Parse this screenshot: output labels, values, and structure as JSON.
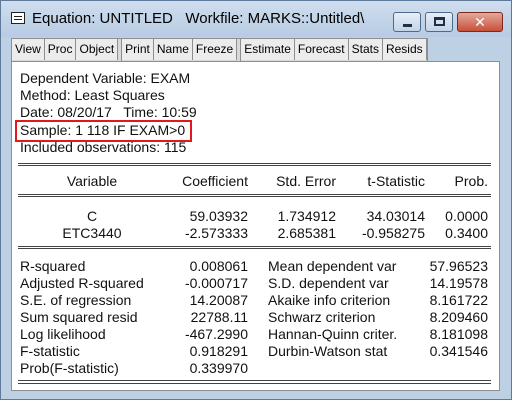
{
  "window": {
    "title": "Equation: UNTITLED   Workfile: MARKS::Untitled\\",
    "controls": {
      "minimize_icon": "minimize-icon",
      "maximize_icon": "maximize-icon",
      "close_icon": "close-icon",
      "close_glyph": "✕"
    }
  },
  "toolbar": {
    "buttons": [
      "View",
      "Proc",
      "Object",
      "Print",
      "Name",
      "Freeze",
      "Estimate",
      "Forecast",
      "Stats",
      "Resids"
    ]
  },
  "output": {
    "header": {
      "dependent": "Dependent Variable: EXAM",
      "method": "Method: Least Squares",
      "date": "Date: 08/20/17   Time: 10:59",
      "sample": "Sample: 1 118 IF EXAM>0",
      "observations": "Included observations: 115"
    },
    "columns": [
      "Variable",
      "Coefficient",
      "Std. Error",
      "t-Statistic",
      "Prob."
    ],
    "rows": [
      [
        "C",
        "59.03932",
        "1.734912",
        "34.03014",
        "0.0000"
      ],
      [
        "ETC3440",
        "-2.573333",
        "2.685381",
        "-0.958275",
        "0.3400"
      ]
    ],
    "stats_left": [
      [
        "R-squared",
        "0.008061"
      ],
      [
        "Adjusted R-squared",
        "-0.000717"
      ],
      [
        "S.E. of regression",
        "14.20087"
      ],
      [
        "Sum squared resid",
        "22788.11"
      ],
      [
        "Log likelihood",
        "-467.2990"
      ],
      [
        "F-statistic",
        "0.918291"
      ],
      [
        "Prob(F-statistic)",
        "0.339970"
      ]
    ],
    "stats_right": [
      [
        "Mean dependent var",
        "57.96523"
      ],
      [
        "S.D. dependent var",
        "14.19578"
      ],
      [
        "Akaike info criterion",
        "8.161722"
      ],
      [
        "Schwarz criterion",
        "8.209460"
      ],
      [
        "Hannan-Quinn criter.",
        "8.181098"
      ],
      [
        "Durbin-Watson stat",
        "0.341546"
      ]
    ],
    "highlight_color": "#e0191c"
  }
}
